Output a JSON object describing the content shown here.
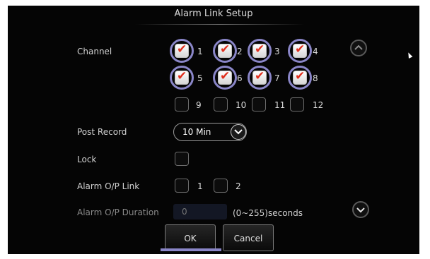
{
  "dialog": {
    "title": "Alarm Link Setup"
  },
  "channel": {
    "label": "Channel",
    "items": [
      {
        "num": "1",
        "checked": true
      },
      {
        "num": "2",
        "checked": true
      },
      {
        "num": "3",
        "checked": true
      },
      {
        "num": "4",
        "checked": true
      },
      {
        "num": "5",
        "checked": true
      },
      {
        "num": "6",
        "checked": true
      },
      {
        "num": "7",
        "checked": true
      },
      {
        "num": "8",
        "checked": true
      },
      {
        "num": "9",
        "checked": false
      },
      {
        "num": "10",
        "checked": false
      },
      {
        "num": "11",
        "checked": false
      },
      {
        "num": "12",
        "checked": false
      }
    ]
  },
  "post_record": {
    "label": "Post Record",
    "value": "10 Min"
  },
  "lock": {
    "label": "Lock",
    "checked": false
  },
  "alarm_link": {
    "label": "Alarm O/P Link",
    "items": [
      {
        "num": "1",
        "checked": false
      },
      {
        "num": "2",
        "checked": false
      }
    ]
  },
  "alarm_duration": {
    "label": "Alarm O/P Duration",
    "placeholder": "0",
    "suffix": "(0~255)seconds"
  },
  "buttons": {
    "ok": "OK",
    "cancel": "Cancel"
  },
  "icons": {
    "scroll_up": "chevron-up-icon",
    "scroll_down": "chevron-down-icon",
    "check": "check-icon"
  },
  "colors": {
    "check_mark": "#e0301e",
    "highlight_ring": "#8a86c8"
  }
}
